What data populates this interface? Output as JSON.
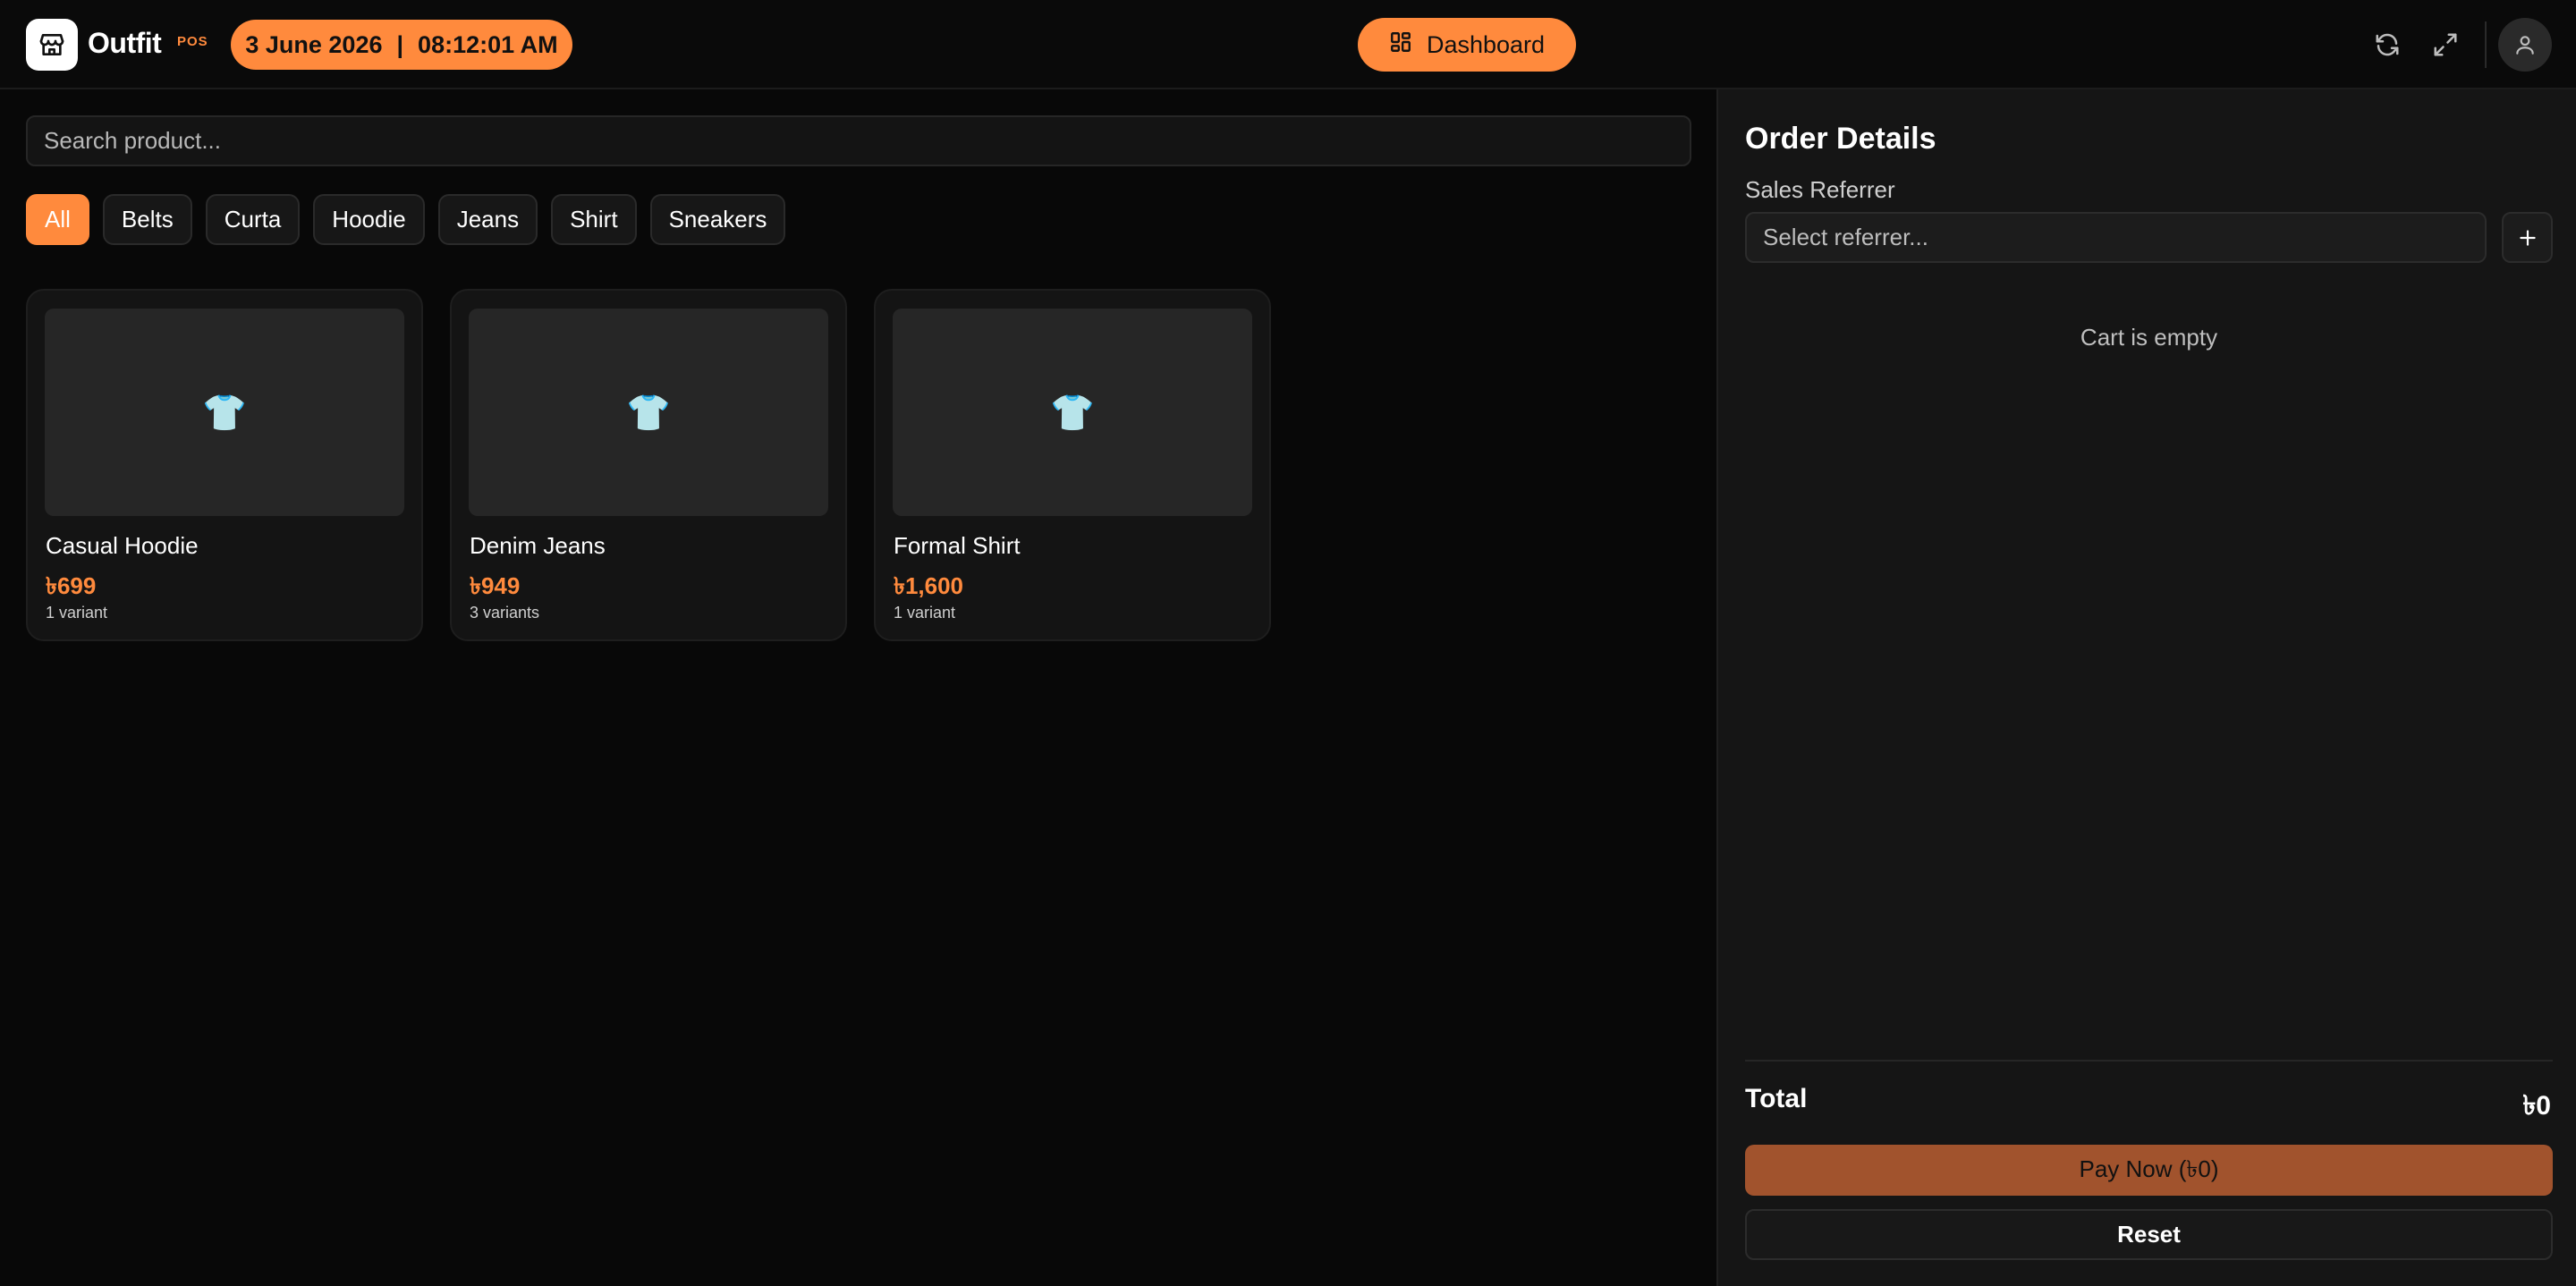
{
  "header": {
    "logo_text": "Outfit",
    "logo_sup": "POS",
    "logo_icon": "store-icon",
    "date": "3 June 2026",
    "separator": "|",
    "time": "08:12:01 AM",
    "dashboard_label": "Dashboard",
    "dashboard_icon": "grid-icon",
    "icons": [
      "refresh-icon",
      "fullscreen-icon",
      "user-icon"
    ]
  },
  "search": {
    "placeholder": "Search product..."
  },
  "categories": [
    "All",
    "Belts",
    "Curta",
    "Hoodie",
    "Jeans",
    "Shirt",
    "Sneakers"
  ],
  "active_category": "All",
  "products": [
    {
      "name": "Casual Hoodie",
      "price": "৳699",
      "variants": "1 variant",
      "icon": "👕"
    },
    {
      "name": "Denim Jeans",
      "price": "৳949",
      "variants": "3 variants",
      "icon": "👕"
    },
    {
      "name": "Formal Shirt",
      "price": "৳1,600",
      "variants": "1 variant",
      "icon": "👕"
    }
  ],
  "order": {
    "title": "Order Details",
    "referrer_label": "Sales Referrer",
    "referrer_placeholder": "Select referrer...",
    "cart_empty": "Cart is empty",
    "total_label": "Total",
    "total_value": "৳0",
    "pay_label": "Pay Now (৳0)",
    "reset_label": "Reset"
  },
  "colors": {
    "accent": "#ff8a3d",
    "pay_button": "#a1532d",
    "background": "#080808",
    "panel": "#151515"
  }
}
